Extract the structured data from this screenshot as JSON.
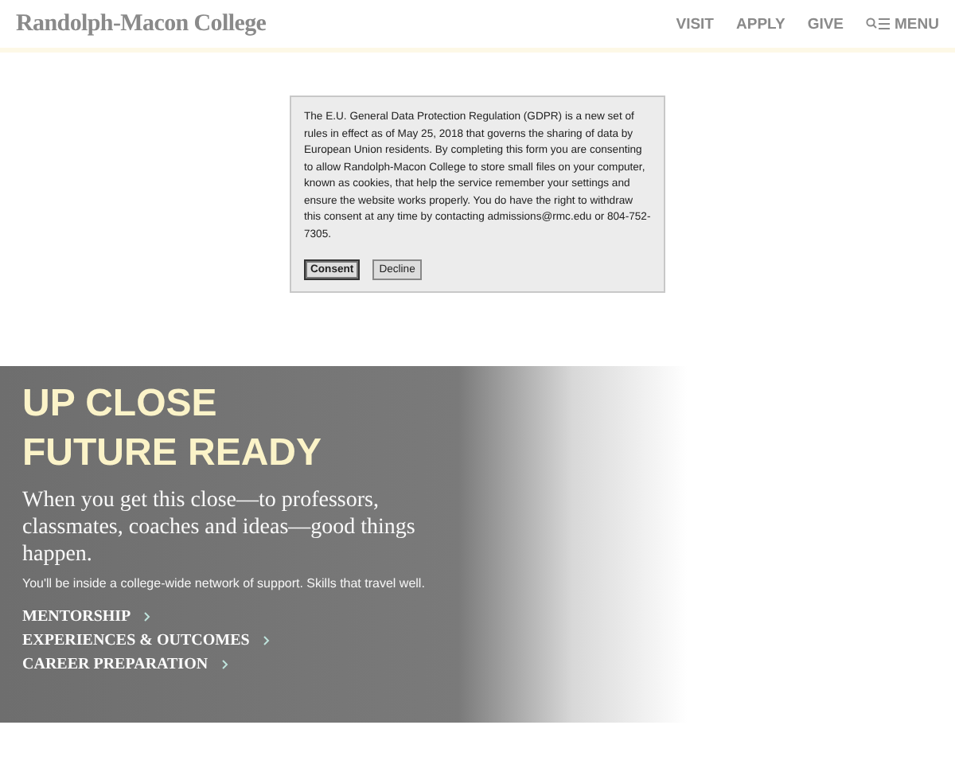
{
  "header": {
    "logo": "Randolph-Macon College",
    "nav": [
      "VISIT",
      "APPLY",
      "GIVE"
    ],
    "menu": "MENU"
  },
  "consent": {
    "text": "The E.U. General Data Protection Regulation (GDPR) is a new set of rules in effect as of May 25, 2018 that governs the sharing of data by European Union residents. By completing this form you are consenting to allow Randolph-Macon College to store small files on your computer, known as cookies, that help the service remember your settings and ensure the website works properly. You do have the right to withdraw this consent at any time by contacting admissions@rmc.edu or 804-752-7305.",
    "buttons": [
      {
        "label": "Consent",
        "selected": true
      },
      {
        "label": "Decline",
        "selected": false
      }
    ]
  },
  "hero": {
    "headline": [
      "UP CLOSE",
      "FUTURE READY"
    ],
    "lead": "When you get this close—to professors, classmates, coaches and ideas—good things happen.",
    "body": "You'll be inside a college-wide network of support. Skills that travel well.",
    "links": [
      "MENTORSHIP",
      "EXPERIENCES & OUTCOMES",
      "CAREER PREPARATION"
    ]
  }
}
